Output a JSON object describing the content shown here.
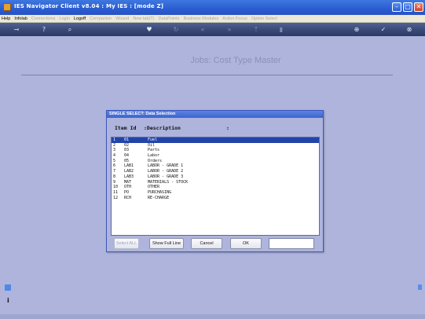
{
  "window": {
    "title": "IES Navigator Client v8.04 : My IES :     [mode Z]",
    "minimize_glyph": "–",
    "maximize_glyph": "□",
    "close_glyph": "✕"
  },
  "menu": [
    {
      "label": "Help",
      "enabled": true
    },
    {
      "label": "Infolab",
      "enabled": true
    },
    {
      "label": "Connections",
      "enabled": false
    },
    {
      "label": "Login",
      "enabled": false
    },
    {
      "label": "Logoff",
      "enabled": true
    },
    {
      "label": "Companion",
      "enabled": false
    },
    {
      "label": "Wizard",
      "enabled": false
    },
    {
      "label": "New tab(T)",
      "enabled": false
    },
    {
      "label": "DataPoints",
      "enabled": false
    },
    {
      "label": "Business Modules",
      "enabled": false
    },
    {
      "label": "Action Focus",
      "enabled": false
    },
    {
      "label": "Option Select",
      "enabled": false
    }
  ],
  "toolbar": {
    "icons": [
      "key-icon",
      "help-icon",
      "search-icon",
      "heart-icon",
      "refresh-icon",
      "back-icon",
      "forward-icon",
      "up-icon",
      "trash-icon",
      "add-icon",
      "check-icon",
      "cancel-icon"
    ]
  },
  "page": {
    "heading": "Jobs: Cost Type Master"
  },
  "dialog": {
    "title": "SINGLE SELECT: Data Selection",
    "col_item_id": "Item Id",
    "col_description": ":Description",
    "col_extra": ":",
    "selected_index": 0,
    "rows": [
      {
        "n": "1",
        "id": "01",
        "desc": "Fuel"
      },
      {
        "n": "2",
        "id": "02",
        "desc": "Oil"
      },
      {
        "n": "3",
        "id": "03",
        "desc": "Parts"
      },
      {
        "n": "4",
        "id": "04",
        "desc": "Labor"
      },
      {
        "n": "5",
        "id": "05",
        "desc": "Orders"
      },
      {
        "n": "6",
        "id": "LAB1",
        "desc": "LABOR - GRADE 1"
      },
      {
        "n": "7",
        "id": "LAB2",
        "desc": "LABOR - GRADE 2"
      },
      {
        "n": "8",
        "id": "LAB3",
        "desc": "LABOR - GRADE 3"
      },
      {
        "n": "9",
        "id": "MAT",
        "desc": "MATERIALS - STOCK"
      },
      {
        "n": "10",
        "id": "OTH",
        "desc": "OTHER"
      },
      {
        "n": "11",
        "id": "PO",
        "desc": "PURCHASING"
      },
      {
        "n": "12",
        "id": "RCH",
        "desc": "RE-CHARGE"
      }
    ],
    "buttons": {
      "select_all": "Select ALL",
      "show_full_line": "Show Full Line",
      "cancel": "Cancel",
      "ok": "OK"
    },
    "ok_field_value": ""
  },
  "side": {
    "info_glyph": "i"
  },
  "colors": {
    "background": "#aeb4dc",
    "selection": "#2244a8",
    "titlebar": "#2a5cd1"
  }
}
